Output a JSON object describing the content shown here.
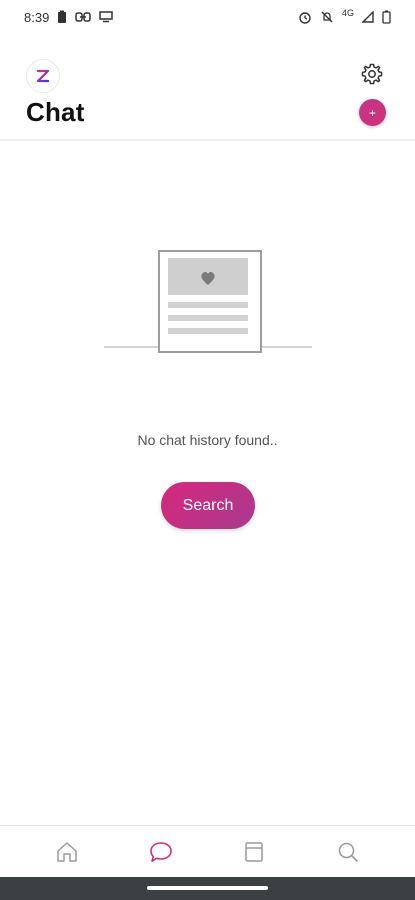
{
  "status_bar": {
    "time": "8:39",
    "network": "4G",
    "icons": [
      "battery-saver-icon",
      "link-icon",
      "notification-icon",
      "alarm-icon",
      "mute-icon",
      "signal-icon",
      "battery-icon"
    ]
  },
  "header": {
    "title": "Chat",
    "logo_letter": "Z",
    "new_chat_label": "+",
    "settings_icon": "gear-icon"
  },
  "empty_state": {
    "message": "No chat history found..",
    "search_button_label": "Search",
    "illustration_icon": "document-heart-icon"
  },
  "bottom_nav": {
    "items": [
      {
        "name": "home",
        "icon": "home-icon",
        "active": false
      },
      {
        "name": "chat",
        "icon": "chat-bubble-icon",
        "active": true
      },
      {
        "name": "saved",
        "icon": "bookmark-page-icon",
        "active": false
      },
      {
        "name": "search",
        "icon": "search-icon",
        "active": false
      }
    ]
  },
  "colors": {
    "accent": "#d12c7e",
    "accent_dark": "#a83a8f",
    "inactive_icon": "#9a9a9a",
    "illustration_gray": "#c8c8c8"
  }
}
